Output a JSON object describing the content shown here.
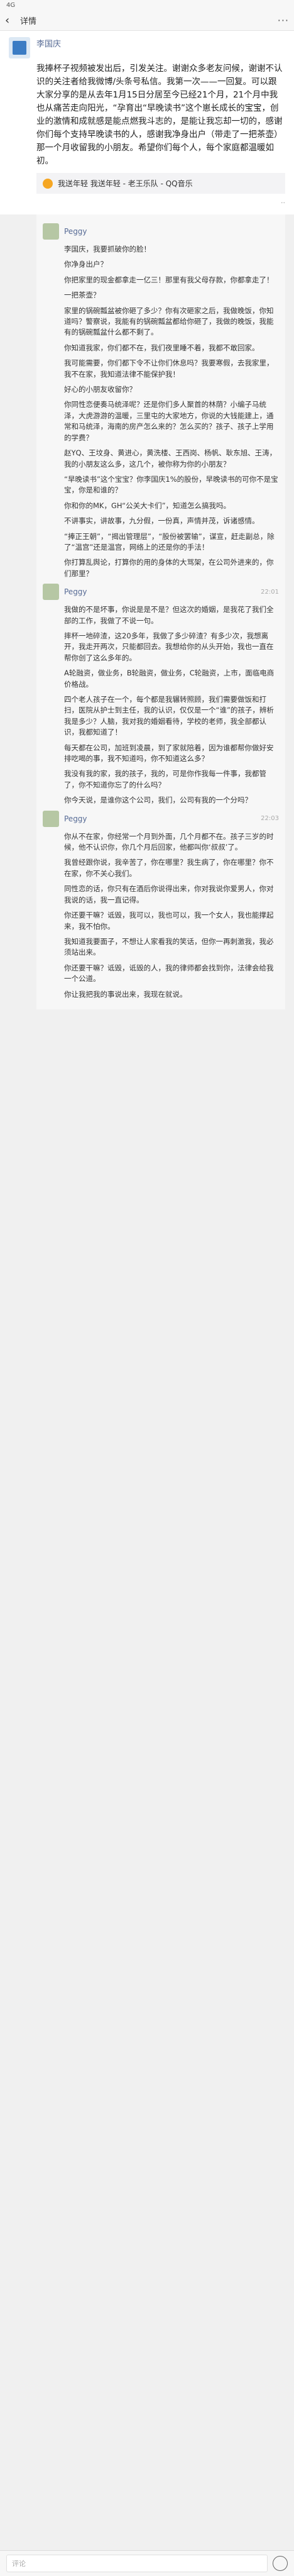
{
  "status": {
    "time": "4G",
    "right": ""
  },
  "appbar": {
    "title": "详情"
  },
  "post": {
    "author": "李国庆",
    "text": "我捧杯子视频被发出后，引发关注。谢谢众多老友问候，谢谢不认识的关注者给我微博/头条号私信。我第一次——一回复。可以跟大家分享的是从去年1月15日分居至今已经21个月，21个月中我也从痛苦走向阳光，“孕育出“早晚读书”这个崽长成长的宝宝，创业的激情和成就感是能点燃我斗志的，是能让我忘却一切的，感谢你们每个支持早晚读书的人，感谢我净身出户（带走了一把茶壶）那一个月收留我的小朋友。希望你们每个人，每个家庭都温暖如初。",
    "share": "我送年轻 我送年轻 - 老王乐队 - QQ音乐",
    "time": "",
    "more": "··"
  },
  "comments": [
    {
      "name": "Peggy",
      "time": "",
      "paragraphs": [
        "李国庆，我要抓破你的脸！",
        "你净身出户？",
        "你把家里的现金都拿走一亿三！那里有我父母存款，你都拿走了！",
        "一把茶壶？",
        "家里的锅碗瓢盆被你砸了多少？你有次砸家之后，我做晚饭，你知道吗？警察说，我能有的锅碗瓢盆都给你砸了，我做的晚饭，我能有的锅碗瓢盆什么都不剩了。",
        "你知道我家，你们都不在，我们夜里睡不着，我都不敢回家。",
        "我可能需要，你们都下令不让你们休息吗？我要寒假，去我家里，我不在家，我知道法律不能保护我！",
        "好心的小朋友收留你？",
        "你同性恋便奏马统泽呢？还是你们多人聚首的林荫？小编子马统泽，大虎游游的温暖，三里屯的大家地方，你说的大钱能建上，通常和马统泽，海南的房产怎么来的？怎么买的？孩子、孩子上学用的学费？",
        "赵YQ、王坟身、黄进心，黄洗楼、王西岗、杨帆、耿东旭、王涛，我的小朋友这么多，这几个，被你称为你的小朋友？",
        "“早晚读书”这个宝宝？你李国庆1%的股份，早晚读书的可你不是宝宝，你是和谁的？",
        "你和你的MK，GH“公关大卡们”，知道怎么搞我吗。",
        "不讲事实，讲故事，九分假，一份真，声情并茂，诉诸感情。",
        "“捧正王朝”，“揭出管理层”，“股份被罢输”，谋宣，赶走副总，除了“温宫”还是温宫，网络上的还是你的手法！",
        "你打算乱舆论，打算你的用的身体的大骂架，在公司外进来的，你们那里？"
      ]
    },
    {
      "name": "Peggy",
      "time": "22:01",
      "paragraphs": [
        "我做的不是坏事，你说是是不是？但这次的婚姻，是我花了我们全部的工作，我做了不说一句。",
        "摔杯一地碎渣，这20多年，我做了多少碎渣？有多少次，我想离开，我走开两次，只能都回去。我想给你的从头开始，我也一直在帮你创了这么多年的。",
        "A轮融资，做业务，B轮融资，做业务，C轮融资，上市，面临电商价格战。",
        "四个老人孩子在一个，每个都是我辗转照顾，我们需要做饭和打扫，医院从护士到主任，我的认识，仅仅是一个“谁”的孩子，辨析我是多少？人脑，我对我的婚姻看待，学校的老师，我全部都认识，我都知道了！",
        "每天都在公司，加班到凌晨，到了家就陪着，因为谁都帮你做好安排吃喝的事，我不知道吗，你不知道这么多？",
        "我没有我的家，我的孩子，我的，可是你作我每一件事，我都管了，你不知道你忘了的什么吗？",
        "你今天说，是谁你这个公司，我们，公司有我的一个分吗？"
      ]
    },
    {
      "name": "Peggy",
      "time": "22:03",
      "paragraphs": [
        "你从不在家，你经常一个月到外面，几个月都不在。孩子三岁的时候，他不认识你，你几个月后回家，他都叫你‘叔叔’了。",
        "我曾经跟你说，我辛苦了，你在哪里？我生病了，你在哪里？你不在家，你不关心我们。",
        "同性恋的话，你只有在酒后你说得出来，你对我说你爱男人，你对我说的话，我一直记得。",
        "你还要干嘛？诋毁，我可以，我也可以，我一个女人，我也能撑起来，我不怕你。",
        "我知道我要面子，不想让人家看我的笑话，但你一再刺激我，我必须站出来。",
        "你还要干嘛？诋毁，诋毁的人，我的律师都会找到你，法律会给我一个公道。",
        "你让我把我的事说出来，我现在就说。"
      ]
    }
  ],
  "bottom": {
    "placeholder": "评论"
  }
}
